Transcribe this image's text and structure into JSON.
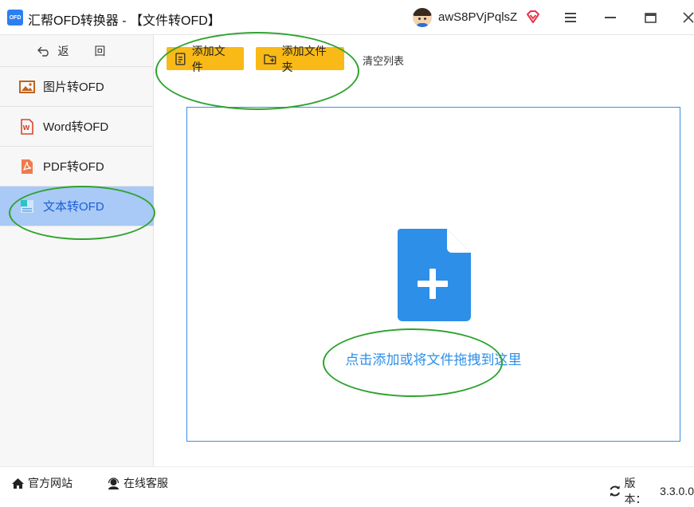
{
  "window": {
    "app_icon_text": "OFD",
    "title": "汇帮OFD转换器 - 【文件转OFD】",
    "username": "awS8PVjPqlsZ"
  },
  "sidebar": {
    "back_label": "返 回",
    "items": [
      {
        "label": "图片转OFD",
        "icon": "image-icon"
      },
      {
        "label": "Word转OFD",
        "icon": "word-icon"
      },
      {
        "label": "PDF转OFD",
        "icon": "pdf-icon"
      },
      {
        "label": "文本转OFD",
        "icon": "text-file-icon",
        "active": true
      }
    ]
  },
  "toolbar": {
    "add_file": "添加文件",
    "add_folder": "添加文件夹",
    "clear_list": "清空列表"
  },
  "dropzone": {
    "text": "点击添加或将文件拖拽到这里"
  },
  "footer": {
    "website": "官方网站",
    "support": "在线客服",
    "version_label": "版本：",
    "version": "3.3.0.0"
  },
  "colors": {
    "accent_button": "#f9b916",
    "active_nav": "#a9c9f6",
    "dropzone_border": "#3a8ee6",
    "annotation_green": "#2ea32e"
  }
}
